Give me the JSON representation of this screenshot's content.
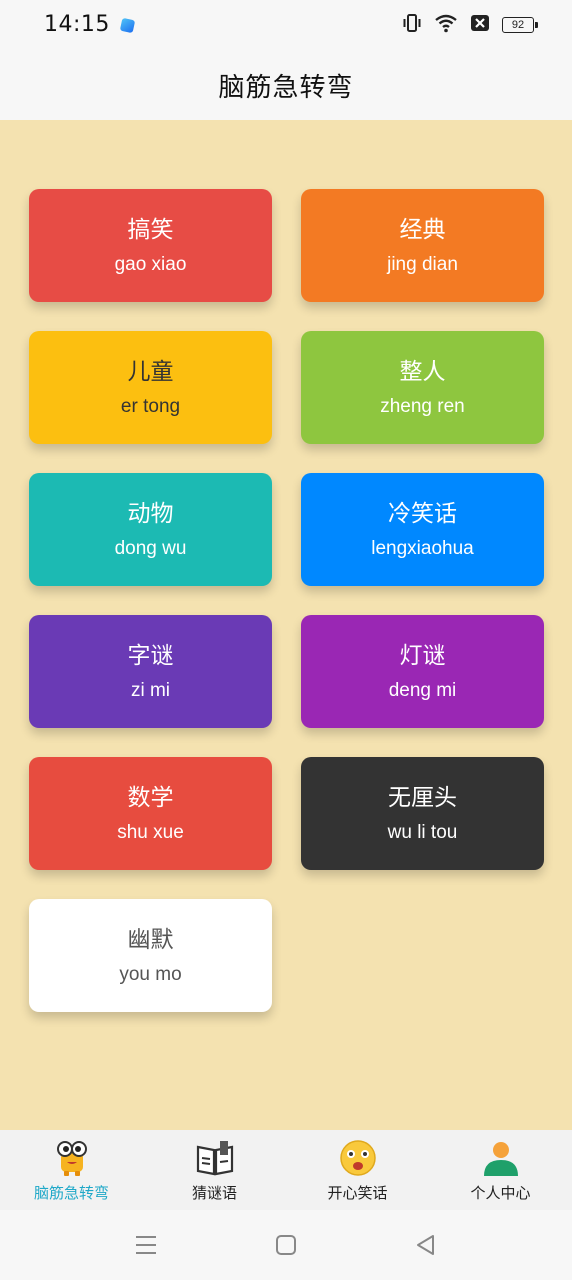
{
  "status": {
    "time": "14:15",
    "battery": "92"
  },
  "header": {
    "title": "脑筋急转弯"
  },
  "categories": [
    {
      "title": "搞笑",
      "subtitle": "gao xiao",
      "color": "#e74c45",
      "text_color": "#ffffff"
    },
    {
      "title": "经典",
      "subtitle": "jing dian",
      "color": "#f37a23",
      "text_color": "#ffffff"
    },
    {
      "title": "儿童",
      "subtitle": "er tong",
      "color": "#fcbf10",
      "text_color": "#333333"
    },
    {
      "title": "整人",
      "subtitle": "zheng ren",
      "color": "#8ec63f",
      "text_color": "#ffffff"
    },
    {
      "title": "动物",
      "subtitle": "dong wu",
      "color": "#1cbab3",
      "text_color": "#ffffff"
    },
    {
      "title": "冷笑话",
      "subtitle": "lengxiaohua",
      "color": "#0088ff",
      "text_color": "#ffffff"
    },
    {
      "title": "字谜",
      "subtitle": "zi mi",
      "color": "#6a3ab5",
      "text_color": "#ffffff"
    },
    {
      "title": "灯谜",
      "subtitle": "deng mi",
      "color": "#9a27b4",
      "text_color": "#ffffff"
    },
    {
      "title": "数学",
      "subtitle": "shu xue",
      "color": "#e74c3f",
      "text_color": "#ffffff"
    },
    {
      "title": "无厘头",
      "subtitle": "wu li tou",
      "color": "#333333",
      "text_color": "#ffffff"
    },
    {
      "title": "幽默",
      "subtitle": "you mo",
      "color": "#ffffff",
      "text_color": "#555555"
    }
  ],
  "tabs": [
    {
      "label": "脑筋急转弯",
      "icon": "cartoon-character-icon",
      "active": true
    },
    {
      "label": "猜谜语",
      "icon": "book-icon",
      "active": false
    },
    {
      "label": "开心笑话",
      "icon": "smiley-face-icon",
      "active": false
    },
    {
      "label": "个人中心",
      "icon": "person-icon",
      "active": false
    }
  ],
  "colors": {
    "background": "#f4e2b0",
    "active_tab": "#1fa8c8"
  }
}
